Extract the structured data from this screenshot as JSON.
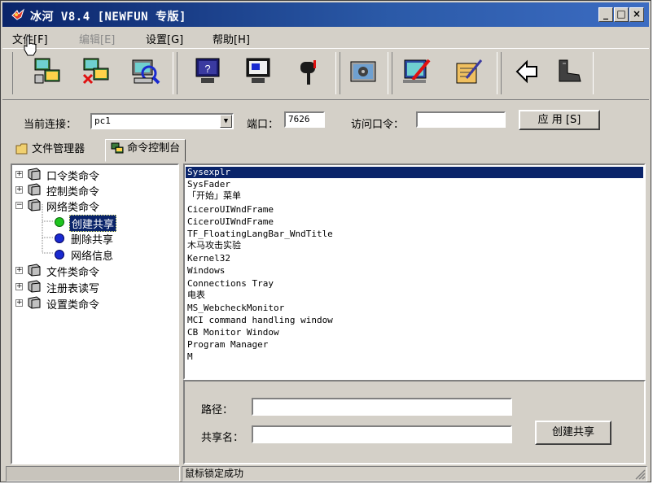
{
  "window": {
    "title": "冰河 V8.4 [NEWFUN 专版]"
  },
  "title_buttons": {
    "minimize": "_",
    "maximize": "□",
    "close": "×"
  },
  "menu": [
    {
      "label": "文件[F]",
      "disabled": false
    },
    {
      "label": "编辑[E]",
      "disabled": true
    },
    {
      "label": "设置[G]",
      "disabled": false
    },
    {
      "label": "帮助[H]",
      "disabled": false
    }
  ],
  "toolbar_icons": [
    "auto-search-icon",
    "add-host-icon",
    "search-host-icon",
    "help-icon",
    "monitor-icon",
    "mailbox-icon",
    "settings-icon",
    "configure-icon",
    "edit-icon",
    "back-icon",
    "exit-icon"
  ],
  "connection": {
    "label": "当前连接：",
    "current": "pc1",
    "port_label": "端口：",
    "port": "7626",
    "password_label": "访问口令：",
    "password": "",
    "apply_label": "应 用 [S]"
  },
  "tabs": [
    {
      "label": "文件管理器",
      "icon": "folder-icon",
      "active": false
    },
    {
      "label": "命令控制台",
      "icon": "computer-icon",
      "active": true
    }
  ],
  "tree": [
    {
      "label": "口令类命令",
      "level": 0,
      "expander": "+",
      "kind": "folder"
    },
    {
      "label": "控制类命令",
      "level": 0,
      "expander": "+",
      "kind": "folder"
    },
    {
      "label": "网络类命令",
      "level": 0,
      "expander": "-",
      "kind": "folder"
    },
    {
      "label": "创建共享",
      "level": 1,
      "kind": "dot",
      "color": "#1fc41f",
      "selected": true
    },
    {
      "label": "删除共享",
      "level": 1,
      "kind": "dot",
      "color": "#1a2ad0"
    },
    {
      "label": "网络信息",
      "level": 1,
      "kind": "dot",
      "color": "#1a2ad0"
    },
    {
      "label": "文件类命令",
      "level": 0,
      "expander": "+",
      "kind": "folder"
    },
    {
      "label": "注册表读写",
      "level": 0,
      "expander": "+",
      "kind": "folder"
    },
    {
      "label": "设置类命令",
      "level": 0,
      "expander": "+",
      "kind": "folder"
    }
  ],
  "window_list": [
    "Sysexplr",
    "SysFader",
    "「开始」菜单",
    "CiceroUIWndFrame",
    "CiceroUIWndFrame",
    "TF_FloatingLangBar_WndTitle",
    "木马攻击实验",
    "Kernel32",
    "Windows",
    "Connections Tray",
    "电表",
    "MS_WebcheckMonitor",
    "MCI command handling window",
    "CB Monitor Window",
    "Program Manager",
    "M"
  ],
  "share": {
    "path_label": "路径：",
    "path_value": "",
    "name_label": "共享名：",
    "name_value": "",
    "create_label": "创建共享"
  },
  "status": {
    "message": "鼠标锁定成功"
  },
  "colors": {
    "title_bar": "#0a246a",
    "face": "#d4d0c8",
    "selection": "#0a246a"
  }
}
